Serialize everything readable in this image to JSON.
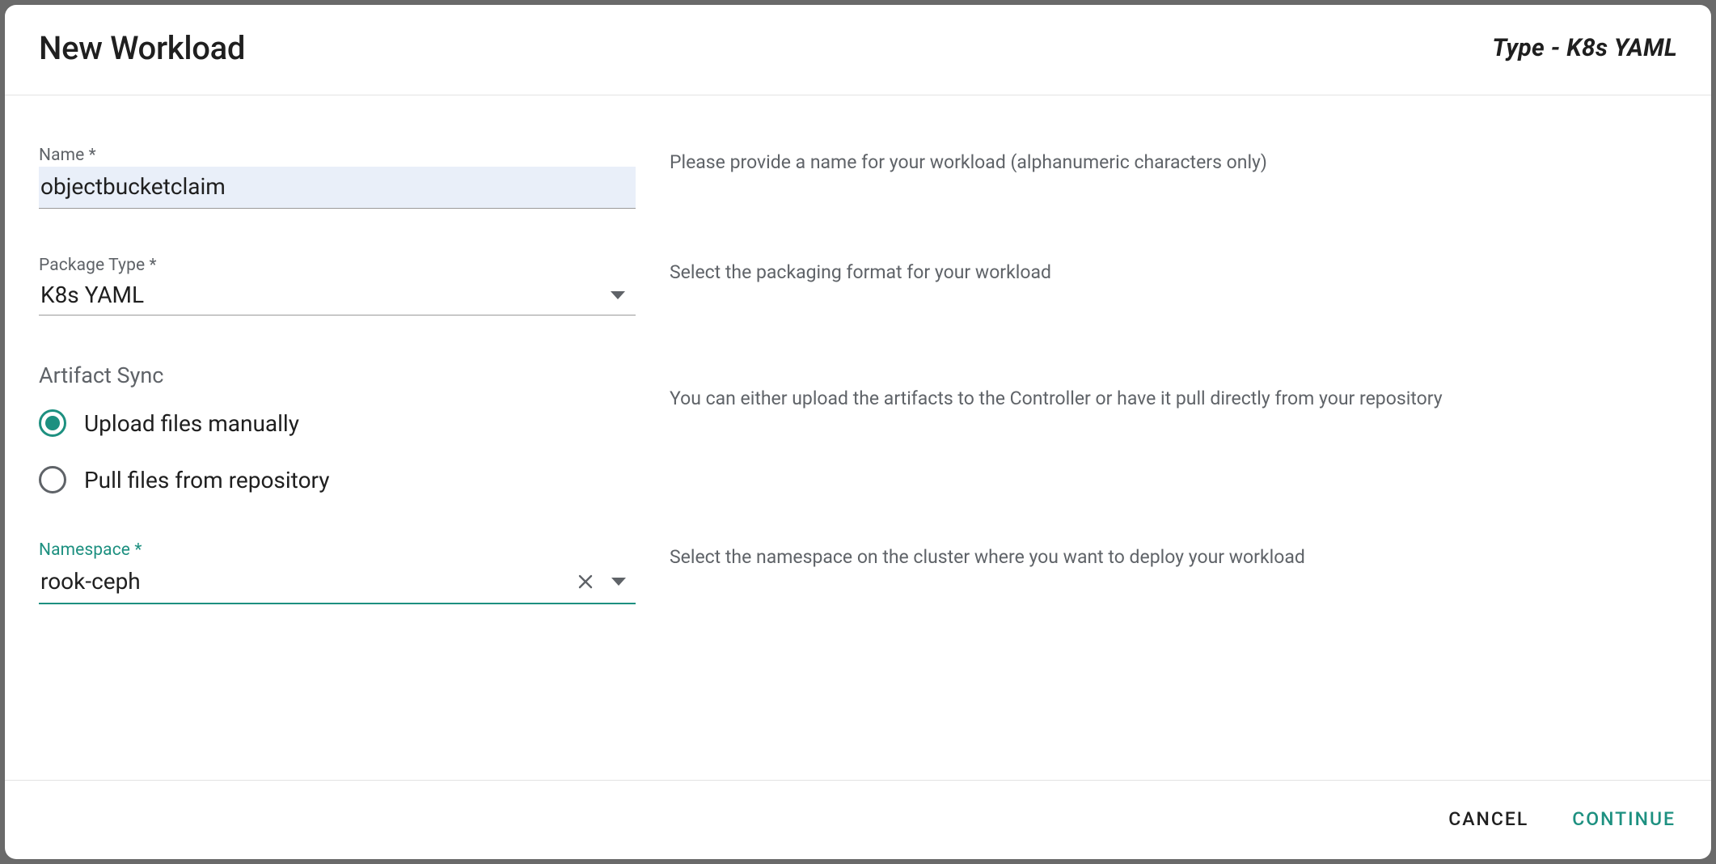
{
  "header": {
    "title": "New Workload",
    "type_prefix": "Type - ",
    "type_value": "K8s YAML"
  },
  "fields": {
    "name": {
      "label": "Name *",
      "value": "objectbucketclaim",
      "helper": "Please provide a name for your workload (alphanumeric characters only)"
    },
    "package_type": {
      "label": "Package Type *",
      "value": "K8s YAML",
      "helper": "Select the packaging format for your workload"
    },
    "artifact_sync": {
      "heading": "Artifact Sync",
      "helper": "You can either upload the artifacts to the Controller or have it pull directly from your repository",
      "options": [
        {
          "label": "Upload files manually",
          "selected": true
        },
        {
          "label": "Pull files from repository",
          "selected": false
        }
      ]
    },
    "namespace": {
      "label": "Namespace *",
      "value": "rook-ceph",
      "helper": "Select the namespace on the cluster where you want to deploy your workload"
    }
  },
  "footer": {
    "cancel": "CANCEL",
    "continue": "CONTINUE"
  },
  "colors": {
    "accent": "#1d9080",
    "text_muted": "#5f6368"
  }
}
